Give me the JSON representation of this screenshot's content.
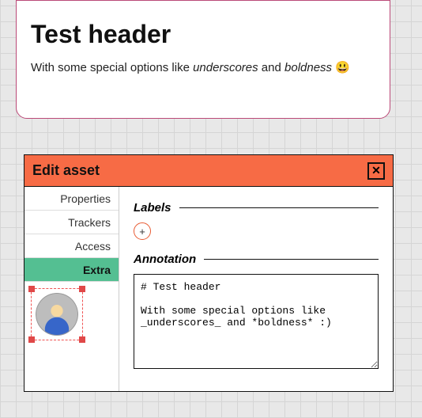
{
  "preview": {
    "title": "Test header",
    "body_prefix": "With some special options like ",
    "body_em1": "underscores",
    "body_mid": " and ",
    "body_em2": "boldness",
    "body_suffix": " ",
    "emoji": "😃"
  },
  "dialog": {
    "title": "Edit asset",
    "close_aria": "Close",
    "tabs": {
      "properties": "Properties",
      "trackers": "Trackers",
      "access": "Access",
      "extra": "Extra"
    },
    "sections": {
      "labels": "Labels",
      "annotation": "Annotation"
    },
    "add_label_glyph": "+",
    "annotation_value": "# Test header\n\nWith some special options like\n_underscores_ and *boldness* :)"
  }
}
